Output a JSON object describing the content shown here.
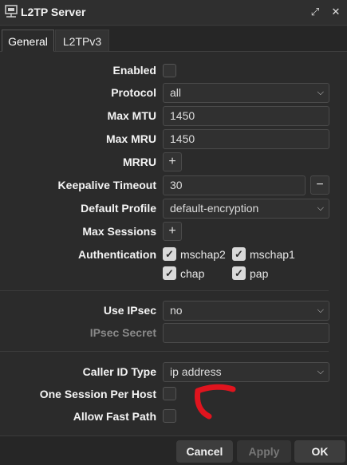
{
  "window": {
    "title": "L2TP Server",
    "icon": "network-server-icon",
    "restore_icon": "restore-icon",
    "close_icon": "close-icon"
  },
  "tabs": [
    {
      "label": "General",
      "active": true
    },
    {
      "label": "L2TPv3",
      "active": false
    }
  ],
  "form": {
    "enabled": {
      "label": "Enabled",
      "checked": false
    },
    "protocol": {
      "label": "Protocol",
      "value": "all"
    },
    "max_mtu": {
      "label": "Max MTU",
      "value": "1450"
    },
    "max_mru": {
      "label": "Max MRU",
      "value": "1450"
    },
    "mrru": {
      "label": "MRRU",
      "add_icon": "plus-icon"
    },
    "keepalive_timeout": {
      "label": "Keepalive Timeout",
      "value": "30",
      "remove_icon": "minus-icon"
    },
    "default_profile": {
      "label": "Default Profile",
      "value": "default-encryption"
    },
    "max_sessions": {
      "label": "Max Sessions",
      "add_icon": "plus-icon"
    },
    "authentication": {
      "label": "Authentication",
      "options": [
        {
          "name": "mschap2",
          "checked": true
        },
        {
          "name": "mschap1",
          "checked": true
        },
        {
          "name": "chap",
          "checked": true
        },
        {
          "name": "pap",
          "checked": true
        }
      ]
    },
    "use_ipsec": {
      "label": "Use IPsec",
      "value": "no"
    },
    "ipsec_secret": {
      "label": "IPsec Secret",
      "value": ""
    },
    "caller_id_type": {
      "label": "Caller ID Type",
      "value": "ip address"
    },
    "one_session_per_host": {
      "label": "One Session Per Host",
      "checked": false
    },
    "allow_fast_path": {
      "label": "Allow Fast Path",
      "checked": false
    }
  },
  "footer": {
    "cancel": "Cancel",
    "apply": "Apply",
    "ok": "OK"
  },
  "colors": {
    "background": "#2b2b2b",
    "field": "#303030",
    "annotation": "#e0141e"
  }
}
